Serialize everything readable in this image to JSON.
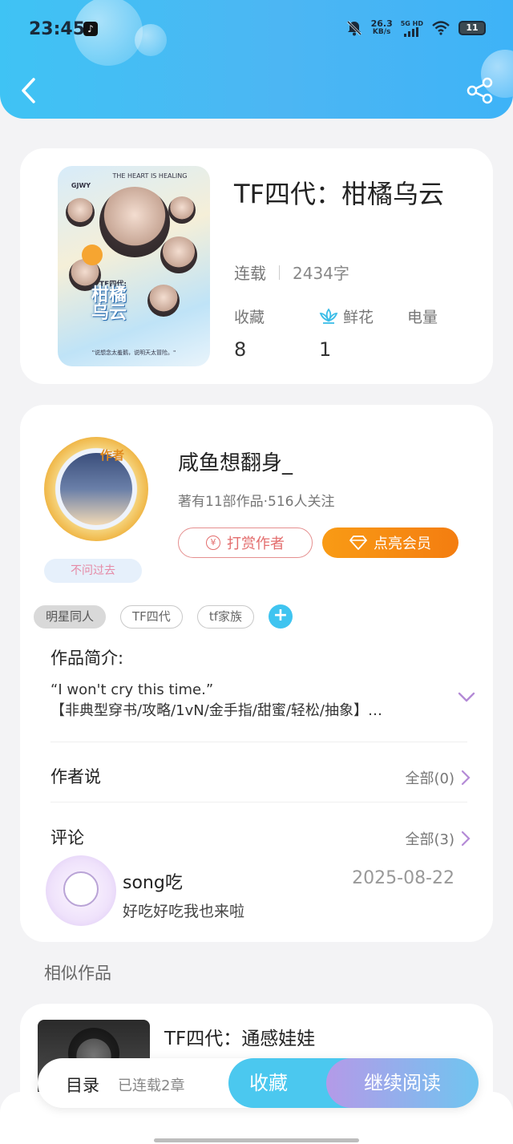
{
  "status_bar": {
    "time": "23:45",
    "net_speed_value": "26.3",
    "net_speed_unit": "KB/s",
    "network": "5G HD",
    "battery": "11"
  },
  "colors": {
    "header": "#45bdf4",
    "accent_blue": "#4bc8ef",
    "tip_red": "#e36d6d",
    "vip_orange": "#f68a12"
  },
  "book": {
    "cover_text": {
      "top": "THE HEART IS HEALING",
      "brand": "GJWY",
      "title": "柑橘乌云",
      "series": "TF四代:",
      "slogan": "\"说想念太羞鹅，说明天太冒险。\""
    },
    "title": "TF四代：柑橘乌云",
    "status": "连载",
    "word_count": "2434字",
    "stats": [
      {
        "label": "收藏",
        "value": "8"
      },
      {
        "label": "鲜花",
        "value": "1",
        "icon": "lotus-icon"
      },
      {
        "label": "电量",
        "value": ""
      }
    ]
  },
  "author": {
    "badge": "作者",
    "fan_badge": "不问过去",
    "name": "咸鱼想翻身_",
    "summary": "著有11部作品·516人关注",
    "tip_label": "打赏作者",
    "vip_label": "点亮会员"
  },
  "tags": [
    "明星同人",
    "TF四代",
    "tf家族"
  ],
  "intro": {
    "title": "作品简介:",
    "line1": "“I won't cry this time.”",
    "line2": "【非典型穿书/攻略/1vN/金手指/甜蜜/轻松/抽象】…"
  },
  "author_says": {
    "title": "作者说",
    "link": "全部(0)"
  },
  "comments": {
    "title": "评论",
    "link": "全部(3)",
    "items": [
      {
        "user": "song吃",
        "date": "2025-08-22",
        "text": "好吃好吃我也来啦"
      }
    ]
  },
  "similar": {
    "label": "相似作品",
    "items": [
      {
        "title": "TF四代：通感娃娃"
      }
    ]
  },
  "bottom_bar": {
    "toc": "目录",
    "toc_status": "已连载2章",
    "favorite": "收藏",
    "continue": "继续阅读"
  }
}
